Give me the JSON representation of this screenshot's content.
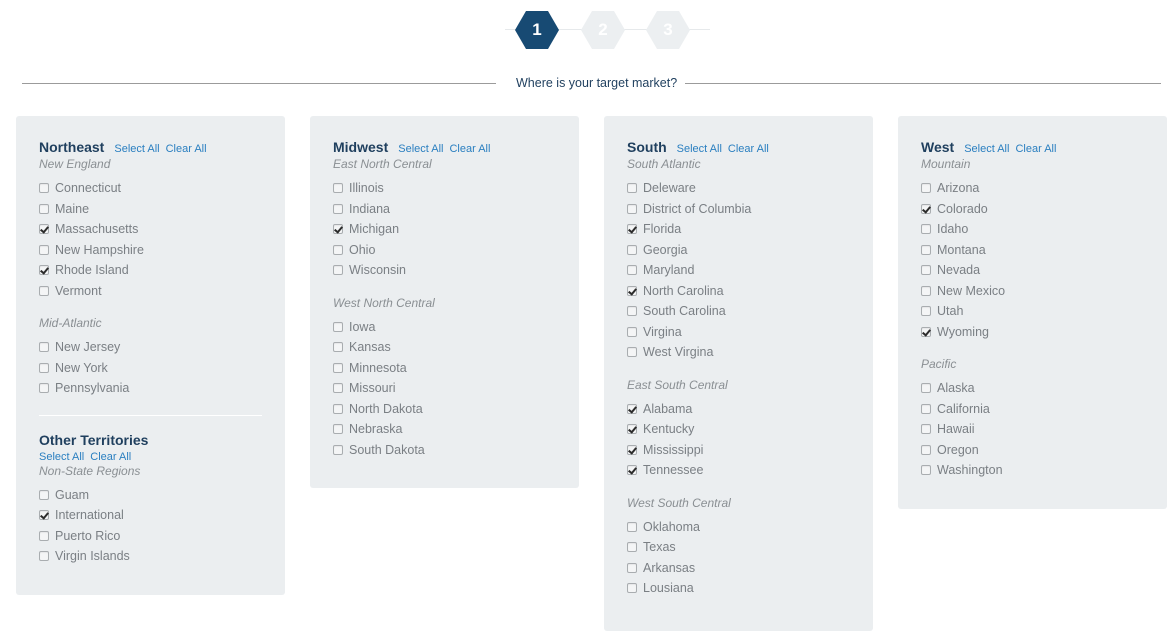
{
  "stepper": {
    "steps": [
      {
        "label": "1",
        "state": "active"
      },
      {
        "label": "2",
        "state": "inactive"
      },
      {
        "label": "3",
        "state": "inactive"
      }
    ],
    "current_step": 1,
    "active_color": "#174a73",
    "inactive_color": "#eceff1"
  },
  "question": "Where is your target market?",
  "links": {
    "select_all": "Select All",
    "clear_all": "Clear All"
  },
  "panels": [
    {
      "title": "Northeast",
      "groups": [
        {
          "name": "New England",
          "items": [
            {
              "label": "Connecticut",
              "checked": false
            },
            {
              "label": "Maine",
              "checked": false
            },
            {
              "label": "Massachusetts",
              "checked": true
            },
            {
              "label": "New Hampshire",
              "checked": false
            },
            {
              "label": "Rhode Island",
              "checked": true
            },
            {
              "label": "Vermont",
              "checked": false
            }
          ]
        },
        {
          "name": "Mid-Atlantic",
          "items": [
            {
              "label": "New Jersey",
              "checked": false
            },
            {
              "label": "New York",
              "checked": false
            },
            {
              "label": "Pennsylvania",
              "checked": false
            }
          ]
        }
      ],
      "extra": {
        "title": "Other Territories",
        "groups": [
          {
            "name": "Non-State Regions",
            "items": [
              {
                "label": "Guam",
                "checked": false
              },
              {
                "label": "International",
                "checked": true
              },
              {
                "label": "Puerto Rico",
                "checked": false
              },
              {
                "label": "Virgin Islands",
                "checked": false
              }
            ]
          }
        ]
      }
    },
    {
      "title": "Midwest",
      "groups": [
        {
          "name": "East North Central",
          "items": [
            {
              "label": "Illinois",
              "checked": false
            },
            {
              "label": "Indiana",
              "checked": false
            },
            {
              "label": "Michigan",
              "checked": true
            },
            {
              "label": "Ohio",
              "checked": false
            },
            {
              "label": "Wisconsin",
              "checked": false
            }
          ]
        },
        {
          "name": "West North Central",
          "items": [
            {
              "label": "Iowa",
              "checked": false
            },
            {
              "label": "Kansas",
              "checked": false
            },
            {
              "label": "Minnesota",
              "checked": false
            },
            {
              "label": "Missouri",
              "checked": false
            },
            {
              "label": "North Dakota",
              "checked": false
            },
            {
              "label": "Nebraska",
              "checked": false
            },
            {
              "label": "South Dakota",
              "checked": false
            }
          ]
        }
      ]
    },
    {
      "title": "South",
      "groups": [
        {
          "name": "South Atlantic",
          "items": [
            {
              "label": "Deleware",
              "checked": false
            },
            {
              "label": "District of Columbia",
              "checked": false
            },
            {
              "label": "Florida",
              "checked": true
            },
            {
              "label": "Georgia",
              "checked": false
            },
            {
              "label": "Maryland",
              "checked": false
            },
            {
              "label": "North Carolina",
              "checked": true
            },
            {
              "label": "South Carolina",
              "checked": false
            },
            {
              "label": "Virgina",
              "checked": false
            },
            {
              "label": "West Virgina",
              "checked": false
            }
          ]
        },
        {
          "name": "East South Central",
          "items": [
            {
              "label": "Alabama",
              "checked": true
            },
            {
              "label": "Kentucky",
              "checked": true
            },
            {
              "label": "Mississippi",
              "checked": true
            },
            {
              "label": "Tennessee",
              "checked": true
            }
          ]
        },
        {
          "name": "West South Central",
          "items": [
            {
              "label": "Oklahoma",
              "checked": false
            },
            {
              "label": "Texas",
              "checked": false
            },
            {
              "label": "Arkansas",
              "checked": false
            },
            {
              "label": "Lousiana",
              "checked": false
            }
          ]
        }
      ]
    },
    {
      "title": "West",
      "groups": [
        {
          "name": "Mountain",
          "items": [
            {
              "label": "Arizona",
              "checked": false
            },
            {
              "label": "Colorado",
              "checked": true
            },
            {
              "label": "Idaho",
              "checked": false
            },
            {
              "label": "Montana",
              "checked": false
            },
            {
              "label": "Nevada",
              "checked": false
            },
            {
              "label": "New Mexico",
              "checked": false
            },
            {
              "label": "Utah",
              "checked": false
            },
            {
              "label": "Wyoming",
              "checked": true
            }
          ]
        },
        {
          "name": "Pacific",
          "items": [
            {
              "label": "Alaska",
              "checked": false
            },
            {
              "label": "California",
              "checked": false
            },
            {
              "label": "Hawaii",
              "checked": false
            },
            {
              "label": "Oregon",
              "checked": false
            },
            {
              "label": "Washington",
              "checked": false
            }
          ]
        }
      ]
    }
  ]
}
